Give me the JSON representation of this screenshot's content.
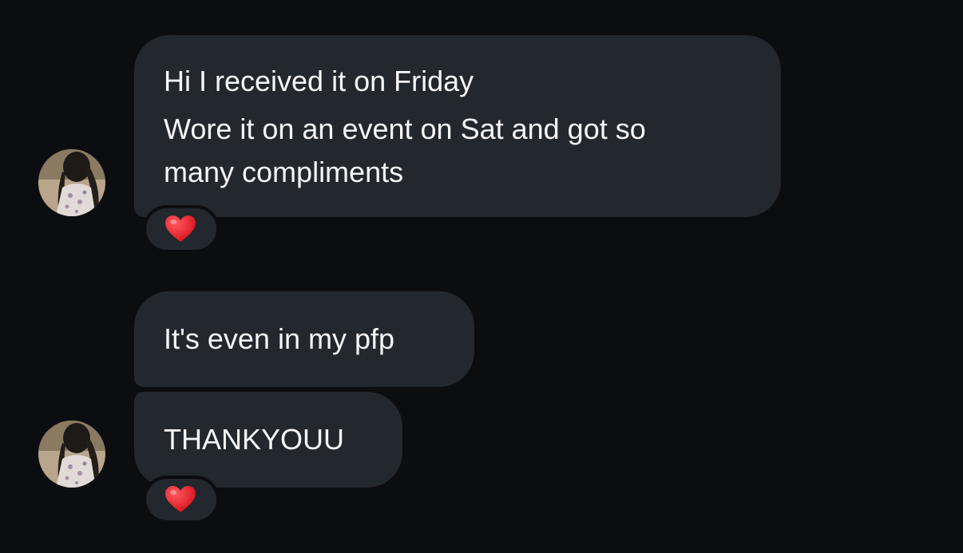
{
  "messages": [
    {
      "lines": [
        "Hi I received it on Friday",
        "Wore it on an event on Sat and got so",
        "many compliments"
      ],
      "reaction": "heart-emoji"
    },
    {
      "lines": [
        "It's even in my pfp"
      ]
    },
    {
      "lines": [
        "THANKYOUU"
      ],
      "reaction": "heart-emoji"
    }
  ],
  "colors": {
    "background": "#0b0d11",
    "bubble": "#23272e",
    "text": "#f5f6f7",
    "heart": "#e8202a"
  }
}
